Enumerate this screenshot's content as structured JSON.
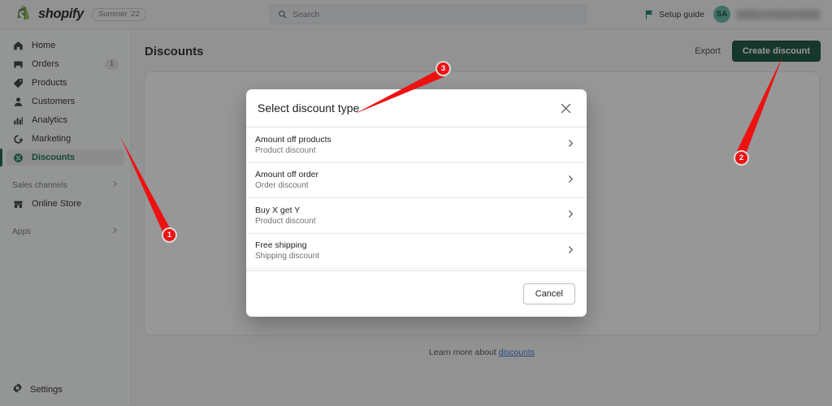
{
  "topbar": {
    "logo_name": "shopify-logo",
    "wordmark": "shopify",
    "season_badge": "Summer '22",
    "search": {
      "placeholder": "Search",
      "value": ""
    },
    "setup_guide_label": "Setup guide",
    "avatar_initials": "SA",
    "store_name": ""
  },
  "sidebar": {
    "items": [
      {
        "label": "Home",
        "icon": "home-icon",
        "badge": ""
      },
      {
        "label": "Orders",
        "icon": "orders-icon",
        "badge": "1"
      },
      {
        "label": "Products",
        "icon": "products-tag-icon",
        "badge": ""
      },
      {
        "label": "Customers",
        "icon": "customers-person-icon",
        "badge": ""
      },
      {
        "label": "Analytics",
        "icon": "analytics-bars-icon",
        "badge": ""
      },
      {
        "label": "Marketing",
        "icon": "marketing-megaphone-icon",
        "badge": ""
      },
      {
        "label": "Discounts",
        "icon": "discounts-icon",
        "badge": "",
        "active": true
      }
    ],
    "sales_channels_label": "Sales channels",
    "online_store_label": "Online Store",
    "apps_label": "Apps",
    "settings_label": "Settings"
  },
  "page": {
    "title": "Discounts",
    "export_label": "Export",
    "create_label": "Create discount",
    "learn_more_prefix": "Learn more about ",
    "learn_more_link": "discounts"
  },
  "modal": {
    "title": "Select discount type",
    "close_icon": "close-icon",
    "options": [
      {
        "title": "Amount off products",
        "subtitle": "Product discount"
      },
      {
        "title": "Amount off order",
        "subtitle": "Order discount"
      },
      {
        "title": "Buy X get Y",
        "subtitle": "Product discount"
      },
      {
        "title": "Free shipping",
        "subtitle": "Shipping discount"
      }
    ],
    "cancel_label": "Cancel"
  },
  "annotations": {
    "color": "#ee1111",
    "markers": [
      {
        "id": "1",
        "label": "1",
        "target": "sidebar-item-discounts"
      },
      {
        "id": "2",
        "label": "2",
        "target": "create-discount-button"
      },
      {
        "id": "3",
        "label": "3",
        "target": "modal-title"
      }
    ]
  },
  "colors": {
    "brand_green": "#0d4a34",
    "accent_link": "#2c6ecb",
    "annotation_red": "#ee1111"
  }
}
